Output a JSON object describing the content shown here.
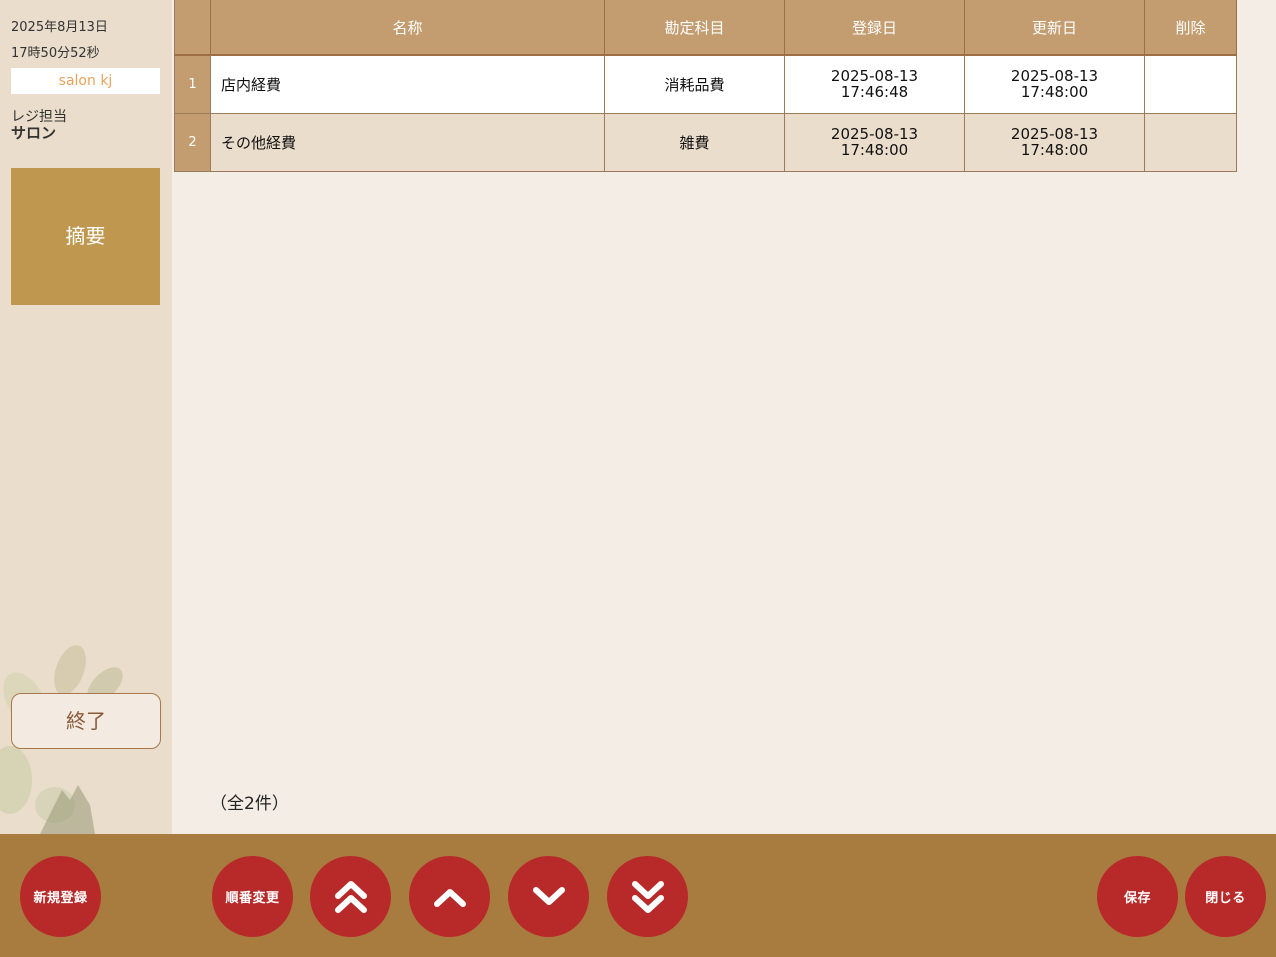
{
  "sidebar": {
    "date": "2025年8月13日",
    "time": "17時50分52秒",
    "salon": "salon kj",
    "staff_label": "レジ担当",
    "staff_name": "サロン",
    "menu_label": "摘要",
    "exit_label": "終了"
  },
  "table": {
    "headers": [
      "",
      "名称",
      "勘定科目",
      "登録日",
      "更新日",
      "削除"
    ],
    "rows": [
      {
        "num": "1",
        "name": "店内経費",
        "account": "消耗品費",
        "created_date": "2025-08-13",
        "created_time": "17:46:48",
        "updated_date": "2025-08-13",
        "updated_time": "17:48:00",
        "delete": ""
      },
      {
        "num": "2",
        "name": "その他経費",
        "account": "雑費",
        "created_date": "2025-08-13",
        "created_time": "17:48:00",
        "updated_date": "2025-08-13",
        "updated_time": "17:48:00",
        "delete": ""
      }
    ]
  },
  "count_label": "（全2件）",
  "toolbar": {
    "new_label": "新規登録",
    "reorder_label": "順番変更",
    "save_label": "保存",
    "close_label": "閉じる",
    "top_icon": "double-chevron-up-icon",
    "up_icon": "chevron-up-icon",
    "down_icon": "chevron-down-icon",
    "bottom_icon": "double-chevron-down-icon"
  },
  "colors": {
    "header_bg": "#c39d70",
    "menu_bg": "#bf974f",
    "bar_bg": "#a87b3f",
    "button_red": "#b82a2a",
    "salon_text": "#e5a45c"
  }
}
